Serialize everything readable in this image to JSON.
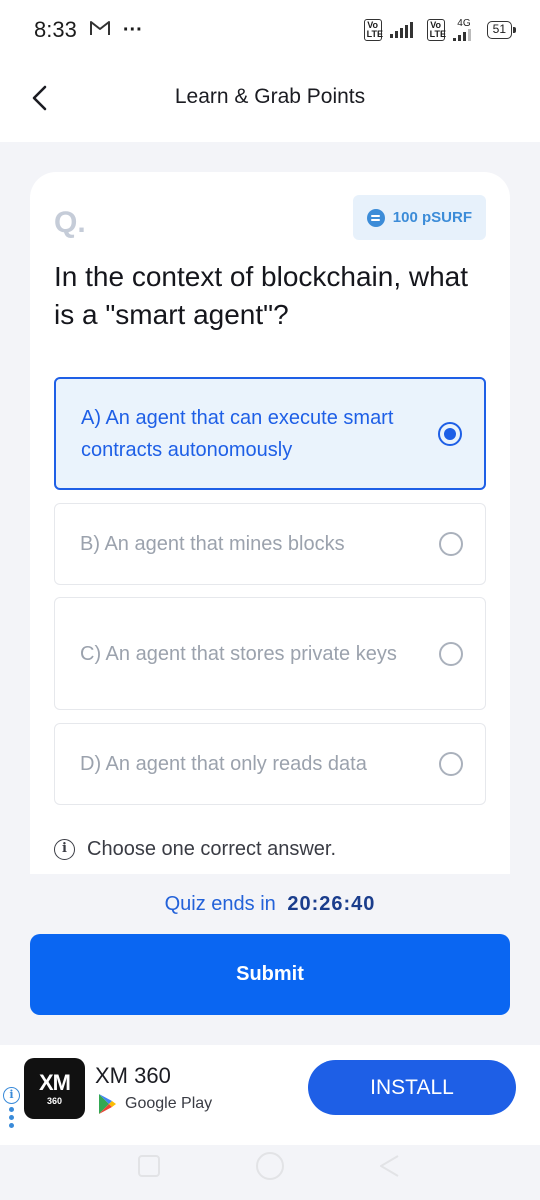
{
  "status_bar": {
    "time": "8:33",
    "gmail_icon": "gmail-icon",
    "more_indicator": "···",
    "sim1_badge": "Vo LTE",
    "sim2_badge": "Vo LTE",
    "network_type": "4G",
    "battery": "51"
  },
  "header": {
    "title": "Learn & Grab Points",
    "back_icon": "chevron-left-icon"
  },
  "quiz": {
    "q_mark": "Q.",
    "reward": "100 pSURF",
    "question": "In the context of blockchain, what is a \"smart agent\"?",
    "options": [
      {
        "label": "A) An agent that can execute smart contracts autonomously",
        "selected": true
      },
      {
        "label": "B) An agent that mines blocks",
        "selected": false
      },
      {
        "label": "C) An agent that stores private keys",
        "selected": false
      },
      {
        "label": "D) An agent that only reads data",
        "selected": false
      }
    ],
    "hint": "Choose one correct answer."
  },
  "timer": {
    "label": "Quiz ends in",
    "time": "20:26:40"
  },
  "submit": {
    "label": "Submit"
  },
  "ad": {
    "logo_text": "XM",
    "logo_sub": "360",
    "title": "XM 360",
    "store": "Google Play",
    "install_label": "INSTALL"
  },
  "colors": {
    "accent": "#1e5fe6",
    "submit_bg": "#0a66f2",
    "page_bg": "#f3f4f8",
    "reward_bg": "#e7f1fb",
    "selected_bg": "#eaf3fc"
  }
}
